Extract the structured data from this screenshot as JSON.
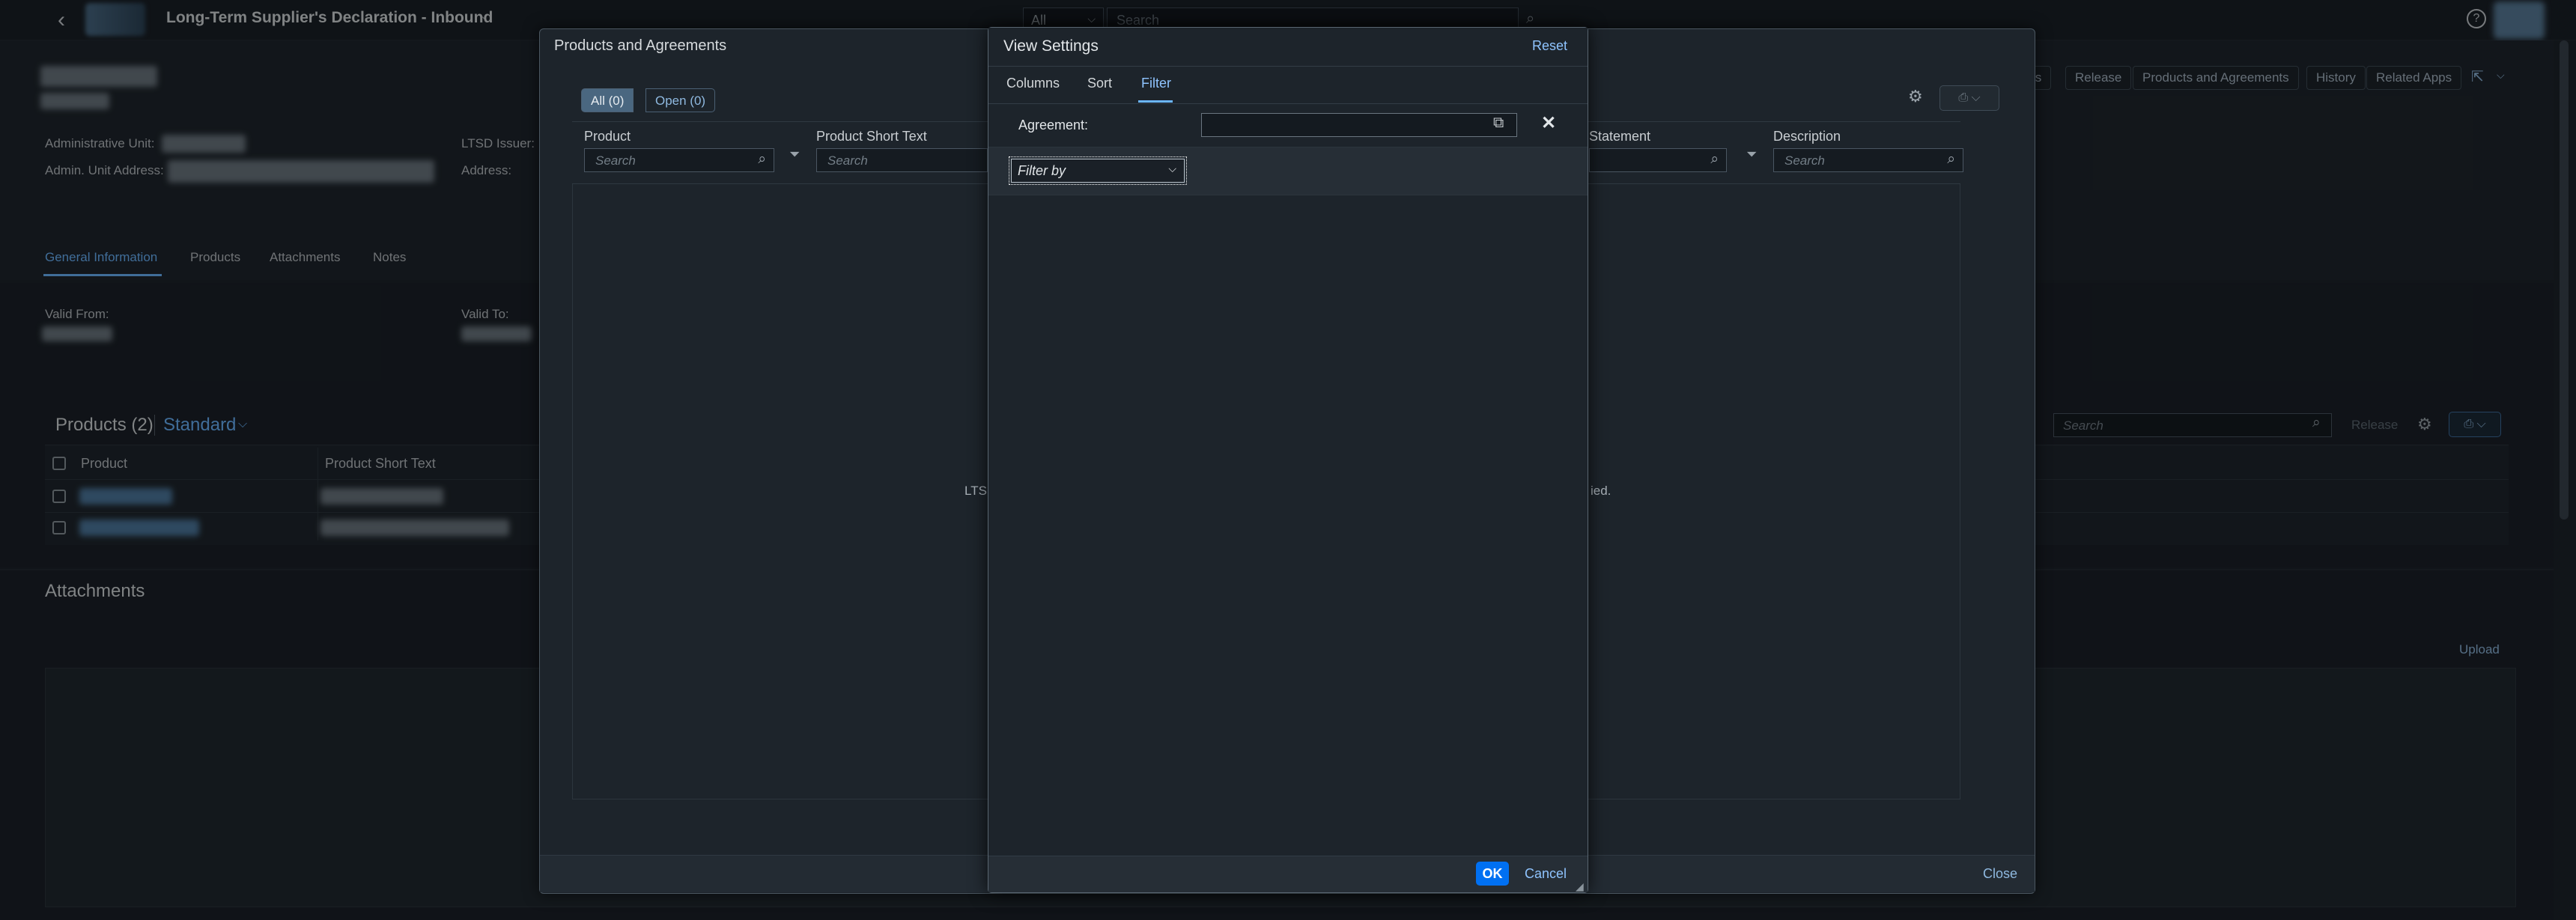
{
  "shell": {
    "title": "Long-Term Supplier's Declaration - Inbound",
    "search_scope": "All",
    "search_placeholder": "Search"
  },
  "object_page": {
    "fields": {
      "admin_unit_label": "Administrative Unit:",
      "admin_unit_address_label": "Admin. Unit Address:",
      "ltsd_issuer_label": "LTSD Issuer:",
      "address_label": "Address:",
      "valid_from_label": "Valid From:",
      "valid_to_label": "Valid To:"
    },
    "header_actions": [
      "ts",
      "Release",
      "Products and Agreements",
      "History",
      "Related Apps"
    ],
    "tabs": [
      "General Information",
      "Products",
      "Attachments",
      "Notes"
    ],
    "products_section": {
      "title": "Products (2)",
      "variant": "Standard",
      "columns": [
        "Product",
        "Product Short Text"
      ],
      "search_placeholder": "Search",
      "release_label": "Release"
    },
    "attachments_section": {
      "title": "Attachments",
      "upload_label": "Upload"
    }
  },
  "products_agreements_dialog": {
    "title": "Products and Agreements",
    "segments": [
      "All (0)",
      "Open (0)"
    ],
    "columns": [
      "Product",
      "Product Short Text",
      "ce Statement",
      "Description"
    ],
    "search_placeholder": "Search",
    "no_data_left": "LTS",
    "no_data_right": "ied.",
    "close_label": "Close"
  },
  "view_settings": {
    "title": "View Settings",
    "reset_label": "Reset",
    "tabs": [
      "Columns",
      "Sort",
      "Filter"
    ],
    "agreement_label": "Agreement:",
    "agreement_value": "",
    "filter_by_placeholder": "Filter by",
    "ok_label": "OK",
    "cancel_label": "Cancel"
  },
  "colors": {
    "accent": "#0070f2",
    "link": "#8fc4ff",
    "background": "#1d232a"
  }
}
